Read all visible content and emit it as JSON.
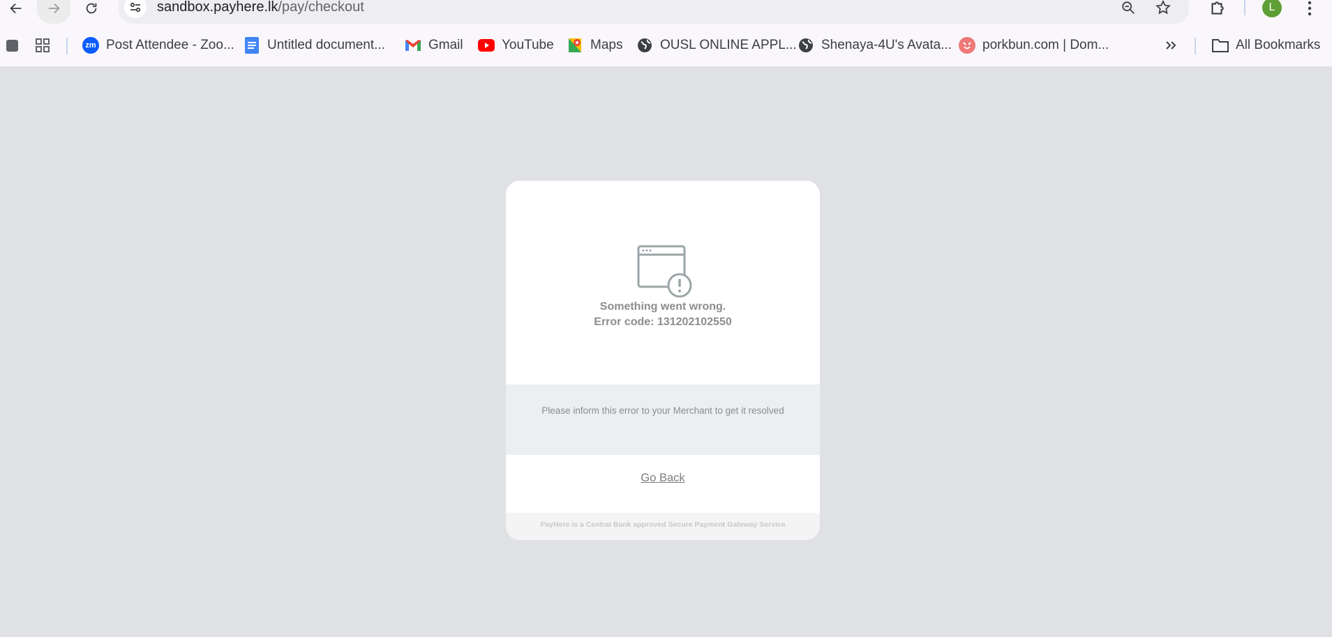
{
  "browser": {
    "url_host": "sandbox.payhere.lk",
    "url_path": "/pay/checkout",
    "profile_initial": "L"
  },
  "bookmarks": {
    "items": [
      {
        "label": "Post Attendee - Zoo...",
        "icon": "zoom-icon",
        "color": "#0b5cff"
      },
      {
        "label": "Untitled document...",
        "icon": "google-docs-icon",
        "color": "#4285f4"
      },
      {
        "label": "Gmail",
        "icon": "gmail-icon",
        "color": "#ea4335"
      },
      {
        "label": "YouTube",
        "icon": "youtube-icon",
        "color": "#ff0000"
      },
      {
        "label": "Maps",
        "icon": "google-maps-icon",
        "color": "#34a853"
      },
      {
        "label": "OUSL ONLINE APPL...",
        "icon": "globe-icon",
        "color": "#3c4043"
      },
      {
        "label": "Shenaya-4U's Avata...",
        "icon": "globe-icon",
        "color": "#3c4043"
      },
      {
        "label": "porkbun.com | Dom...",
        "icon": "porkbun-icon",
        "color": "#ef7878"
      }
    ],
    "all_bookmarks_label": "All Bookmarks"
  },
  "error_card": {
    "title": "Something went wrong.",
    "error_code_line": "Error code: 131202102550",
    "info_message": "Please inform this error to your Merchant to get it resolved",
    "go_back_label": "Go Back",
    "footer_text": "PayHere is a Central Bank approved Secure Payment Gateway Service"
  },
  "colors": {
    "page_background": "#dfe1e5",
    "icon_stroke": "#9aa5a7",
    "info_background": "#eceff1"
  }
}
